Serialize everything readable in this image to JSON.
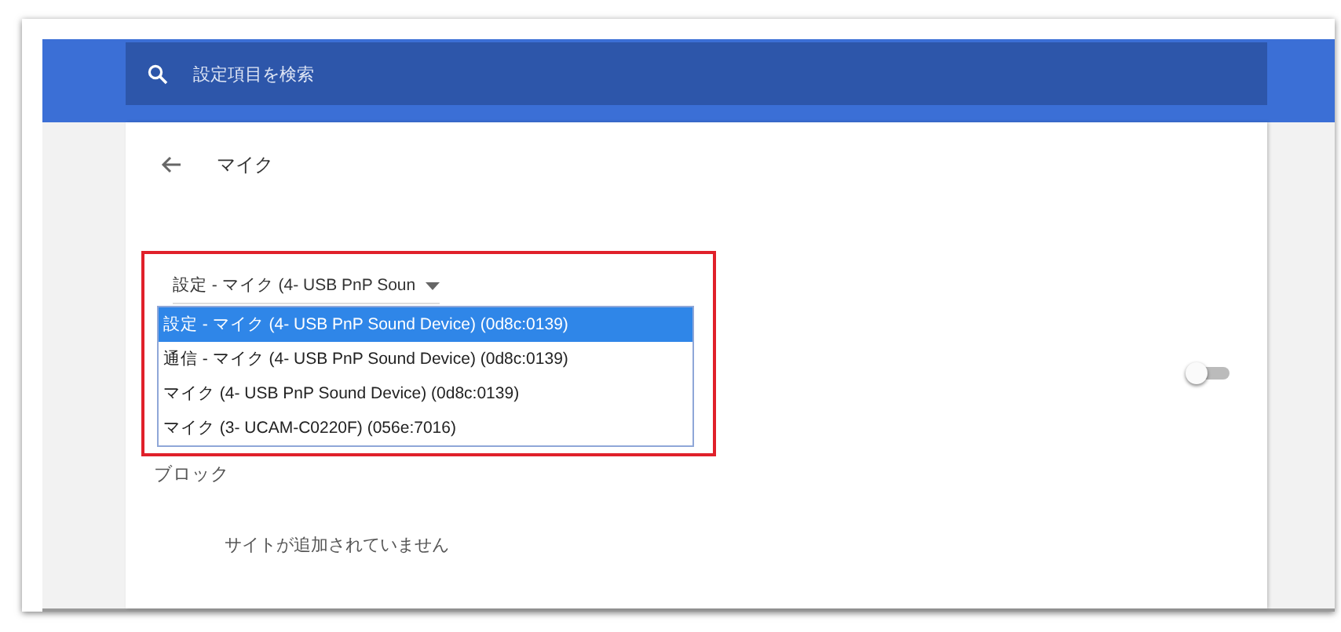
{
  "search": {
    "placeholder": "設定項目を検索"
  },
  "page": {
    "title": "マイク"
  },
  "microphone_select": {
    "value": "設定 - マイク (4- USB PnP Soun",
    "options": [
      {
        "label": "設定 - マイク (4- USB PnP Sound Device) (0d8c:0139)",
        "selected": true
      },
      {
        "label": "通信 - マイク (4- USB PnP Sound Device) (0d8c:0139)",
        "selected": false
      },
      {
        "label": "マイク (4- USB PnP Sound Device) (0d8c:0139)",
        "selected": false
      },
      {
        "label": "マイク (3- UCAM-C0220F) (056e:7016)",
        "selected": false
      }
    ]
  },
  "toggle": {
    "on": false
  },
  "block": {
    "heading": "ブロック",
    "empty_text": "サイトが追加されていません"
  }
}
